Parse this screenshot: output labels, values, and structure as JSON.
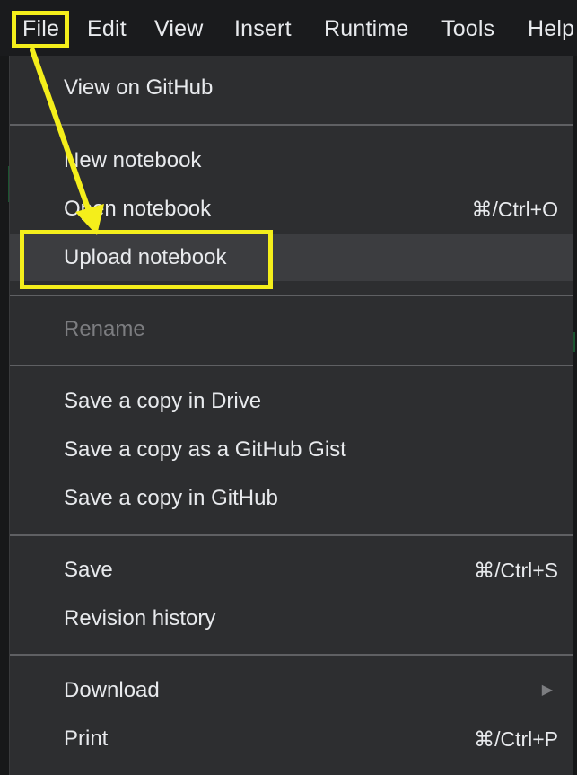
{
  "menubar": {
    "items": [
      {
        "label": "File"
      },
      {
        "label": "Edit"
      },
      {
        "label": "View"
      },
      {
        "label": "Insert"
      },
      {
        "label": "Runtime"
      },
      {
        "label": "Tools"
      },
      {
        "label": "Help"
      }
    ]
  },
  "file_menu": {
    "view_on_github": "View on GitHub",
    "new_notebook": "New notebook",
    "open_notebook": "Open notebook",
    "open_shortcut": "⌘/Ctrl+O",
    "upload_notebook": "Upload notebook",
    "rename": "Rename",
    "save_copy_drive": "Save a copy in Drive",
    "save_copy_gist": "Save a copy as a GitHub Gist",
    "save_copy_github": "Save a copy in GitHub",
    "save": "Save",
    "save_shortcut": "⌘/Ctrl+S",
    "revision_history": "Revision history",
    "download": "Download",
    "print": "Print",
    "print_shortcut": "⌘/Ctrl+P"
  },
  "colors": {
    "annotation": "#f4ee1b",
    "menu_background": "#2d2e30",
    "hover_background": "#3c3d40",
    "text": "#e8eaed",
    "disabled_text": "#7c7d80"
  },
  "icons": {
    "submenu_arrow": "triangle-right-icon",
    "annotation_arrow": "arrow-pointer-icon"
  }
}
